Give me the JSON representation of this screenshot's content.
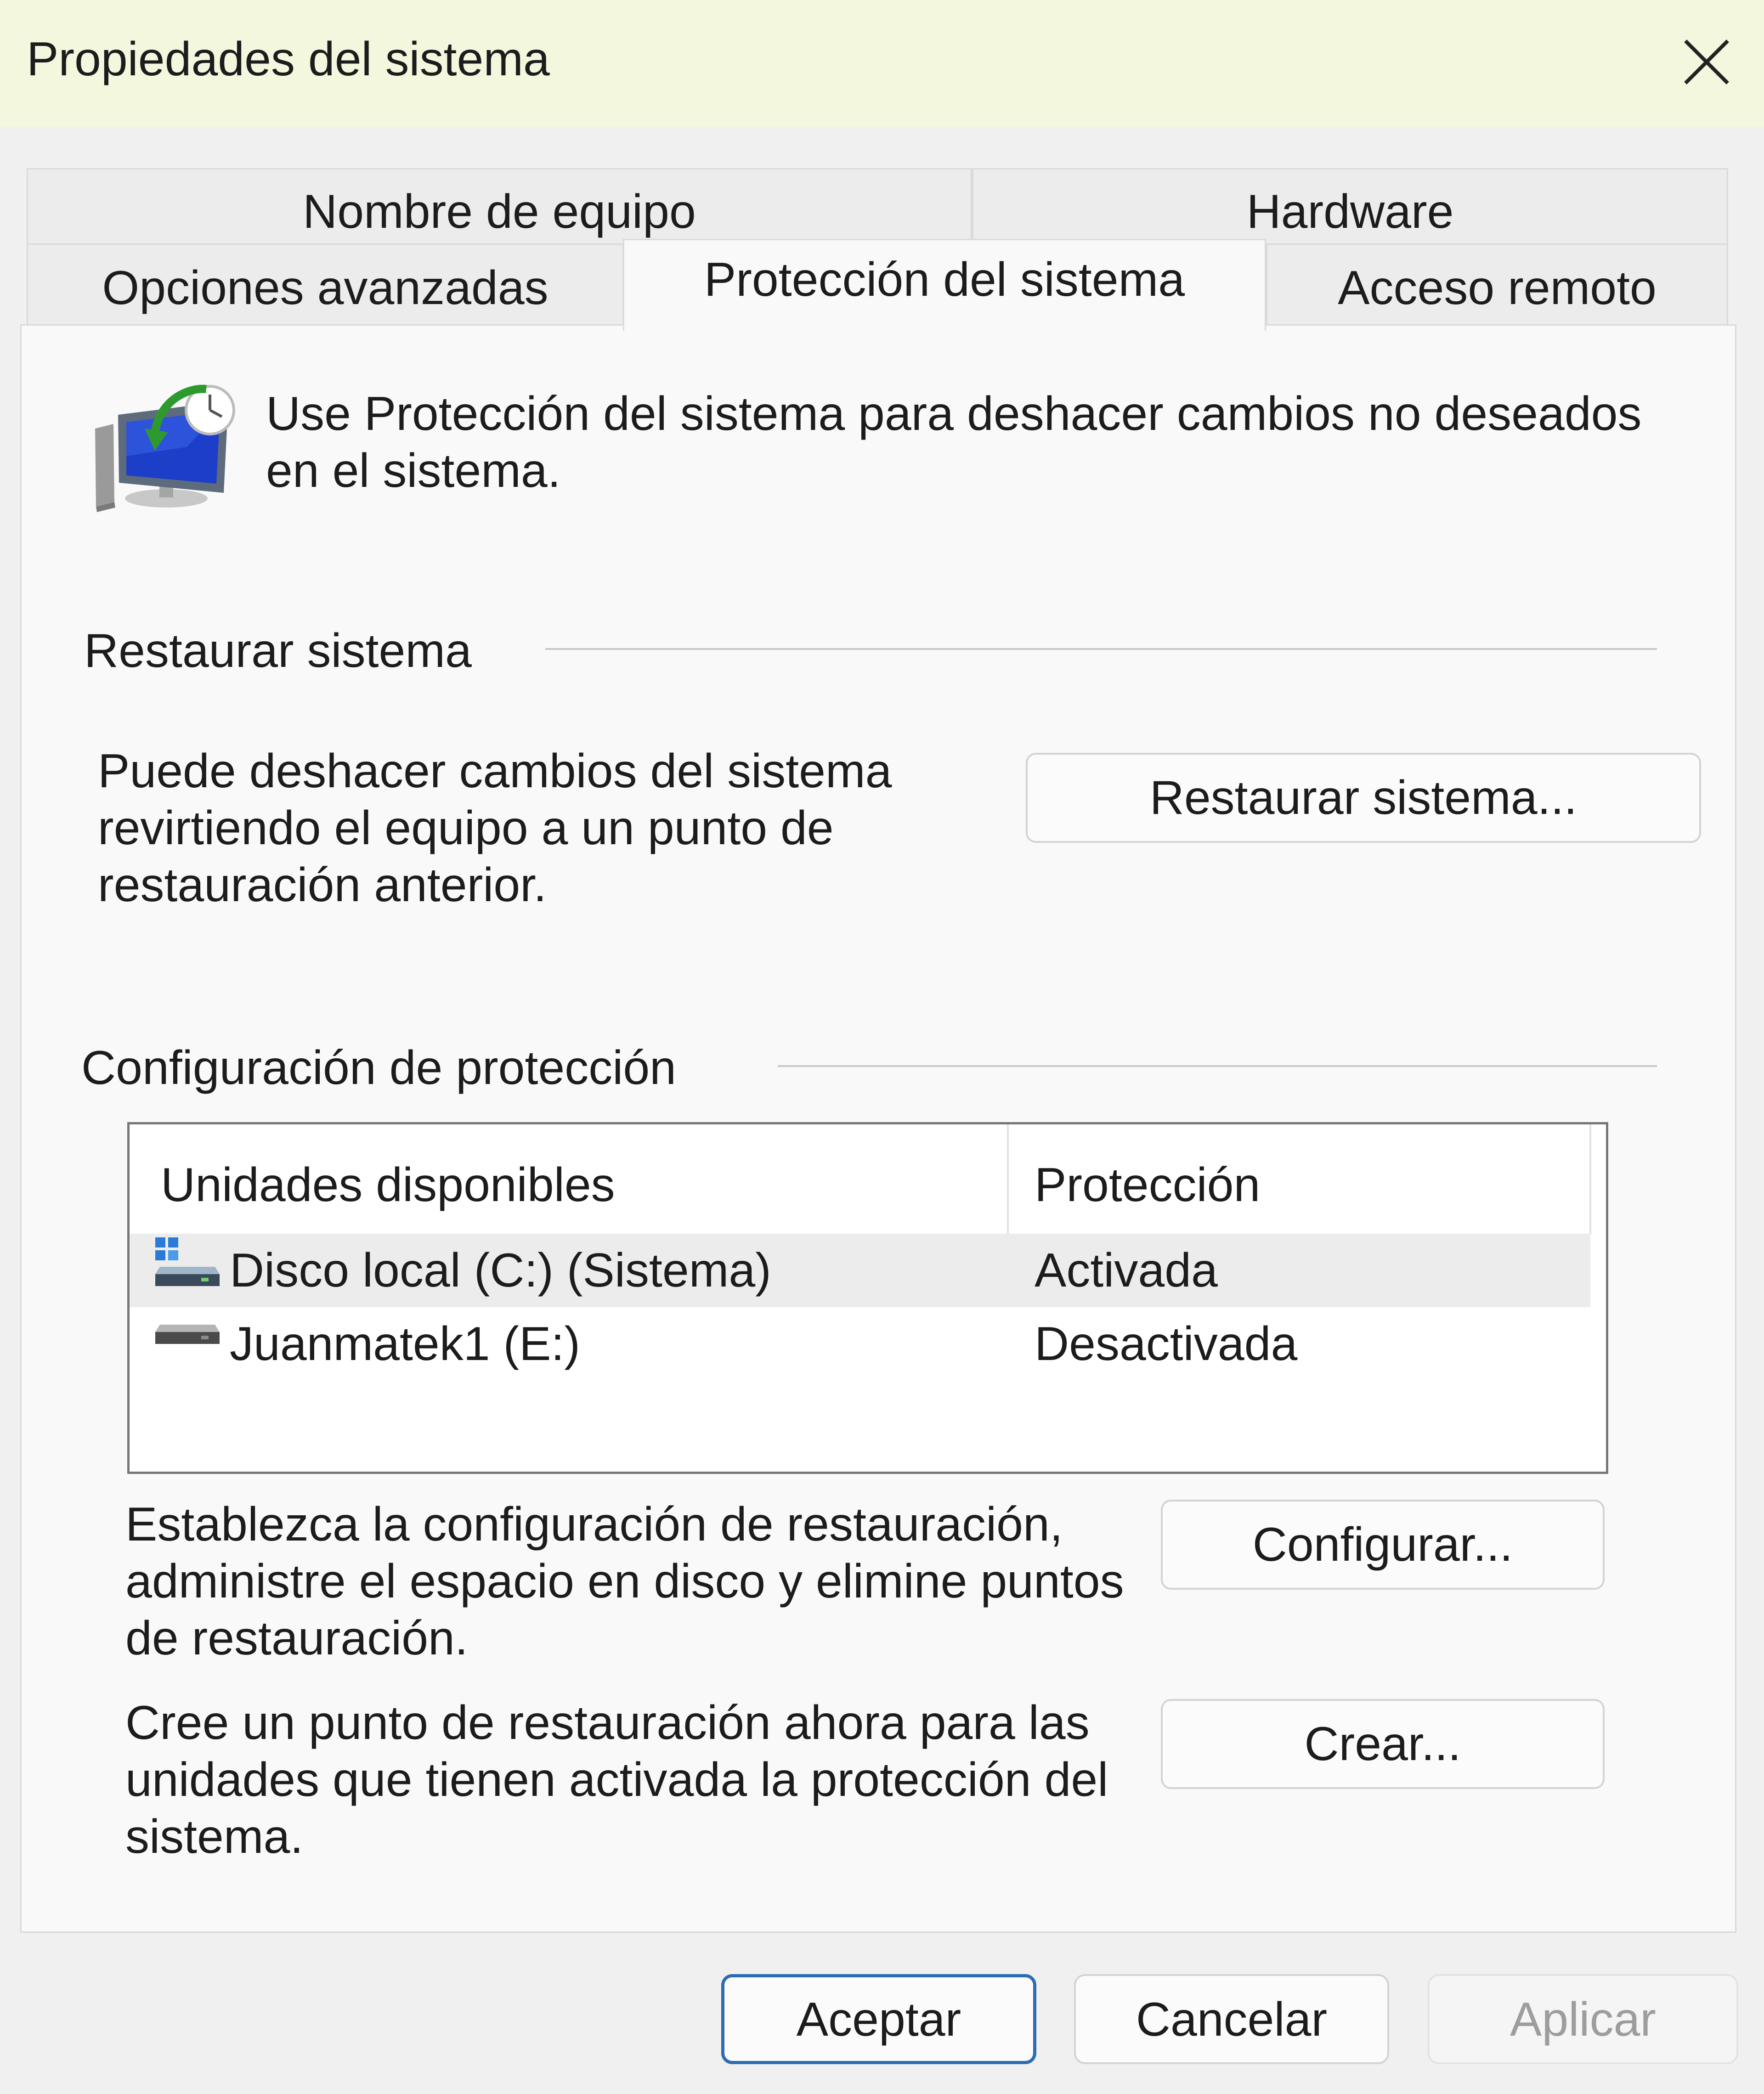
{
  "window": {
    "title": "Propiedades del sistema"
  },
  "tabs": {
    "row_back": [
      "Nombre de equipo",
      "Hardware"
    ],
    "row_front": [
      "Opciones avanzadas",
      "Protección del sistema",
      "Acceso remoto"
    ],
    "active": "Protección del sistema"
  },
  "intro": {
    "text_line1": "Use Protección del sistema para deshacer cambios no deseados",
    "text_line2": "en el sistema."
  },
  "restore": {
    "heading": "Restaurar sistema",
    "desc_line1": "Puede deshacer cambios del sistema",
    "desc_line2": "revirtiendo el equipo a un punto de",
    "desc_line3": "restauración anterior.",
    "button": "Restaurar sistema..."
  },
  "protection": {
    "heading": "Configuración de protección",
    "columns": [
      "Unidades disponibles",
      "Protección"
    ],
    "drives": [
      {
        "name": "Disco local (C:) (Sistema)",
        "status": "Activada",
        "icon": "system-drive-icon",
        "selected": true
      },
      {
        "name": "Juanmatek1 (E:)",
        "status": "Desactivada",
        "icon": "drive-icon",
        "selected": false
      }
    ],
    "config_line1": "Establezca la configuración de restauración,",
    "config_line2": "administre el espacio en disco y elimine puntos",
    "config_line3": "de restauración.",
    "config_button": "Configurar...",
    "create_line1": "Cree un punto de restauración ahora para las",
    "create_line2": "unidades que tienen activada la protección del",
    "create_line3": "sistema.",
    "create_button": "Crear..."
  },
  "footer": {
    "ok": "Aceptar",
    "cancel": "Cancelar",
    "apply": "Aplicar"
  },
  "colors": {
    "titlebar": "#f3f7de",
    "primary_border": "#2c6cb3",
    "selected_row": "#ececec"
  }
}
